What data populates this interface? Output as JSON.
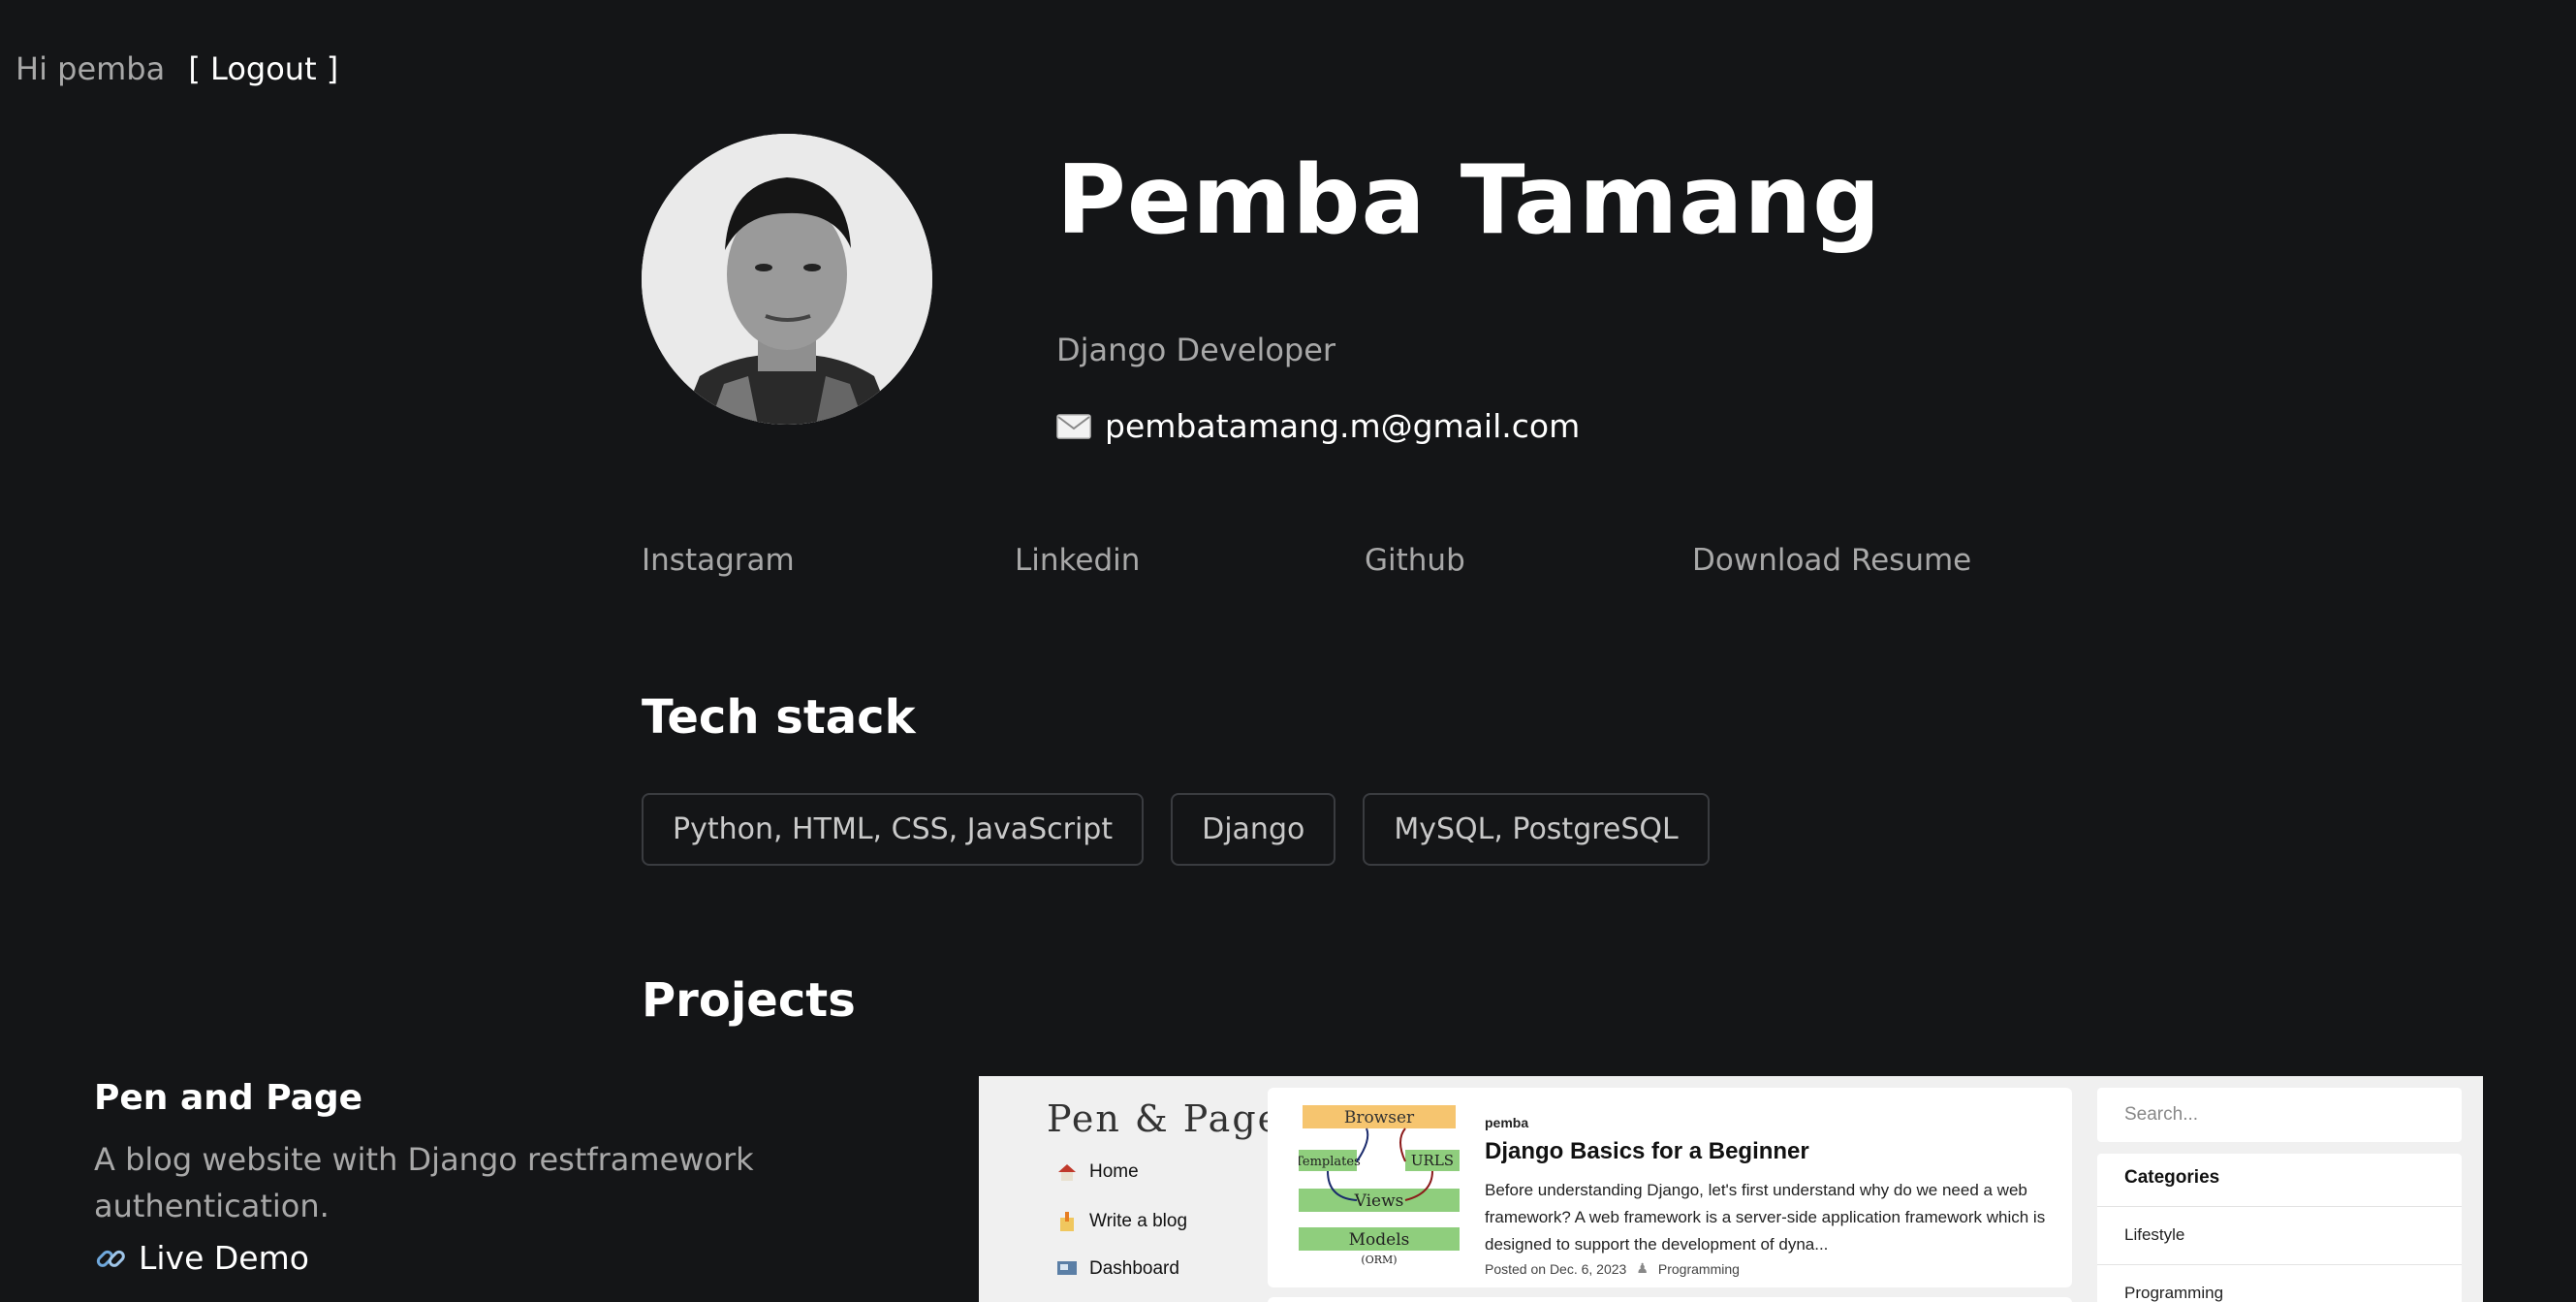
{
  "header": {
    "greeting": "Hi pemba",
    "logout_label": "[ Logout ]"
  },
  "profile": {
    "name": "Pemba Tamang",
    "role": "Django Developer",
    "email": "pembatamang.m@gmail.com",
    "email_icon": "envelope-icon"
  },
  "links": [
    {
      "label": "Instagram"
    },
    {
      "label": "Linkedin"
    },
    {
      "label": "Github"
    },
    {
      "label": "Download Resume"
    }
  ],
  "tech_stack": {
    "title": "Tech stack",
    "items": [
      "Python, HTML, CSS, JavaScript",
      "Django",
      "MySQL, PostgreSQL"
    ]
  },
  "projects": {
    "title": "Projects",
    "items": [
      {
        "title": "Pen and Page",
        "description": "A blog website with Django restframework authentication.",
        "demo_label": "Live Demo",
        "demo_icon": "link-icon",
        "screenshot": {
          "logo": "Pen & Page",
          "nav": [
            {
              "label": "Home",
              "icon": "home-icon"
            },
            {
              "label": "Write a blog",
              "icon": "pencil-icon"
            },
            {
              "label": "Dashboard",
              "icon": "dashboard-icon"
            }
          ],
          "post": {
            "author": "pemba",
            "title": "Django Basics for a Beginner",
            "excerpt": "Before understanding Django, let's first understand why do we need a web framework? A web framework is a server-side application framework which is designed to support the development of dyna...",
            "posted": "Posted on Dec. 6, 2023",
            "category": "Programming",
            "thumb_labels": [
              "Browser",
              "Templates",
              "URLS",
              "Views",
              "Models",
              "(ORM)"
            ]
          },
          "search_placeholder": "Search...",
          "categories": {
            "title": "Categories",
            "items": [
              "Lifestyle",
              "Programming"
            ]
          }
        }
      }
    ]
  },
  "colors": {
    "background": "#141517",
    "muted_text": "#a8a8a8",
    "chip_border": "#3a3c40"
  }
}
